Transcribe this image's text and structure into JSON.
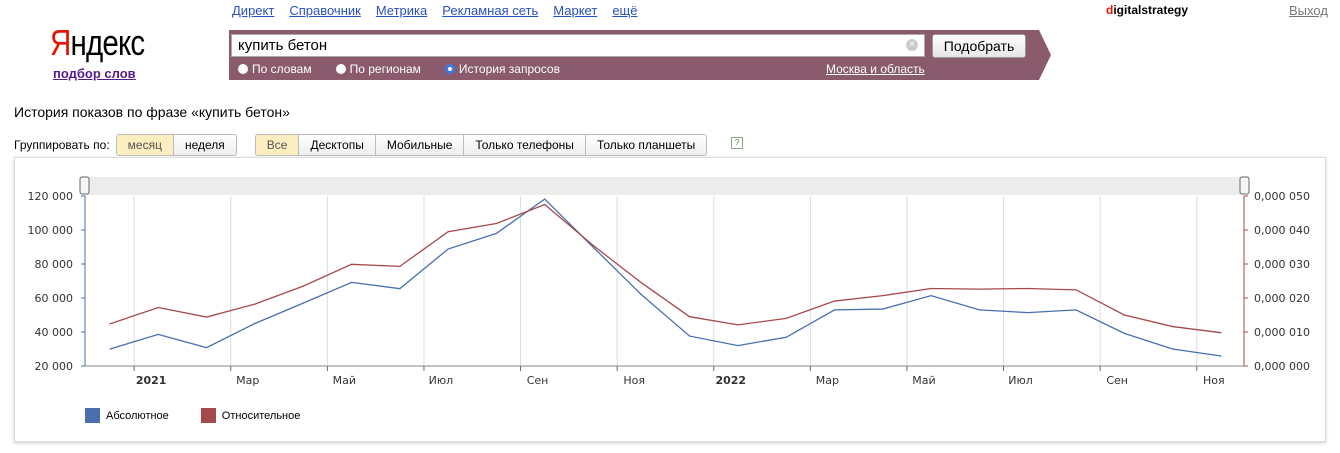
{
  "header": {
    "links": [
      "Директ",
      "Справочник",
      "Метрика",
      "Рекламная сеть",
      "Маркет",
      "ещё"
    ],
    "logo_first": "Я",
    "logo_rest": "ндекс",
    "subtitle": "подбор слов",
    "user_first": "d",
    "user_rest": "igitalstrategy",
    "logout": "Выход"
  },
  "search": {
    "value": "купить бетон",
    "clear_icon": "×",
    "button": "Подобрать",
    "modes": [
      "По словам",
      "По регионам",
      "История запросов"
    ],
    "selected_mode": 2,
    "region": "Москва и область"
  },
  "page": {
    "title": "История показов по фразе «купить бетон»",
    "group_label": "Группировать по:",
    "group_options": [
      "месяц",
      "неделя"
    ],
    "device_options": [
      "Все",
      "Десктопы",
      "Мобильные",
      "Только телефоны",
      "Только планшеты"
    ],
    "help": "?"
  },
  "colors": {
    "absolute": "#4a6fad",
    "relative": "#a54a4a"
  },
  "chart_data": {
    "type": "line",
    "x": [
      "2020-12",
      "2021-01",
      "2021-02",
      "2021-03",
      "2021-04",
      "2021-05",
      "2021-06",
      "2021-07",
      "2021-08",
      "2021-09",
      "2021-10",
      "2021-11",
      "2021-12",
      "2022-01",
      "2022-02",
      "2022-03",
      "2022-04",
      "2022-05",
      "2022-06",
      "2022-07",
      "2022-08",
      "2022-09",
      "2022-10",
      "2022-11"
    ],
    "x_ticks": [
      {
        "label": "2021",
        "month": 1,
        "bold": true
      },
      {
        "label": "Мар",
        "month": 3
      },
      {
        "label": "Май",
        "month": 5
      },
      {
        "label": "Июл",
        "month": 7
      },
      {
        "label": "Сен",
        "month": 9
      },
      {
        "label": "Ноя",
        "month": 11
      },
      {
        "label": "2022",
        "month": 13,
        "bold": true
      },
      {
        "label": "Мар",
        "month": 15
      },
      {
        "label": "Май",
        "month": 17
      },
      {
        "label": "Июл",
        "month": 19
      },
      {
        "label": "Сен",
        "month": 21
      },
      {
        "label": "Ноя",
        "month": 23
      }
    ],
    "y_left": {
      "range": [
        20000,
        120000
      ],
      "ticks": [
        "20 000",
        "40 000",
        "60 000",
        "80 000",
        "100 000",
        "120 000"
      ]
    },
    "y_right": {
      "range": [
        0,
        0.05
      ],
      "ticks": [
        "0,000 000",
        "0,000 010",
        "0,000 020",
        "0,000 030",
        "0,000 040",
        "0,000 050"
      ]
    },
    "series": [
      {
        "name": "Абсолютное",
        "axis": "left",
        "values": [
          30000,
          38600,
          30800,
          45000,
          57000,
          69200,
          65500,
          88800,
          98000,
          118200,
          90000,
          62000,
          37600,
          32000,
          36900,
          53000,
          53500,
          61400,
          53000,
          51400,
          53000,
          39200,
          30000,
          25900
        ]
      },
      {
        "name": "Относительное",
        "axis": "right",
        "values": [
          0.0124,
          0.0172,
          0.0144,
          0.0182,
          0.0235,
          0.0299,
          0.0293,
          0.0395,
          0.0419,
          0.0475,
          0.0355,
          0.0245,
          0.0145,
          0.0121,
          0.014,
          0.0191,
          0.0207,
          0.0228,
          0.0226,
          0.0228,
          0.0224,
          0.015,
          0.0116,
          0.0098
        ]
      }
    ],
    "legend": "bottom-left"
  }
}
